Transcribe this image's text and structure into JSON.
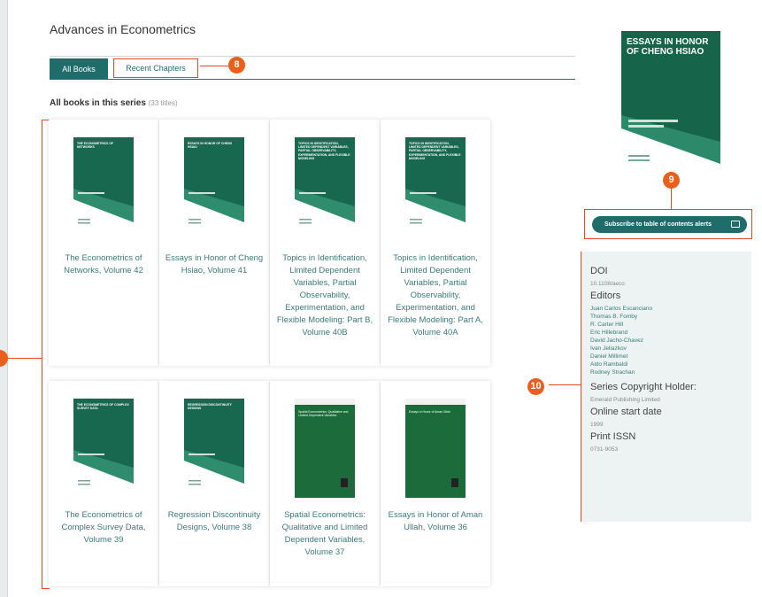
{
  "series_title": "Advances in Econometrics",
  "tabs": {
    "active": "All Books",
    "other": "Recent Chapters"
  },
  "section": {
    "heading": "All books in this series",
    "count": "(33 titles)"
  },
  "badges": {
    "b8": "8",
    "b9": "9",
    "b10": "10"
  },
  "books": [
    {
      "title": "The Econometrics of Networks, Volume 42",
      "cover_text": "THE ECONOMETRICS OF NETWORKS",
      "cover_style": "teal"
    },
    {
      "title": "Essays in Honor of Cheng Hsiao, Volume 41",
      "cover_text": "ESSAYS IN HONOR OF CHENG HSIAO",
      "cover_style": "teal"
    },
    {
      "title": "Topics in Identification, Limited Dependent Variables, Partial Observability, Experimentation, and Flexible Modeling: Part B, Volume 40B",
      "cover_text": "TOPICS IN IDENTIFICATION, LIMITED DEPENDENT VARIABLES, PARTIAL OBSERVABILITY, EXPERIMENTATION, AND FLEXIBLE MODELING",
      "cover_style": "teal"
    },
    {
      "title": "Topics in Identification, Limited Dependent Variables, Partial Observability, Experimentation, and Flexible Modeling: Part A, Volume 40A",
      "cover_text": "TOPICS IN IDENTIFICATION, LIMITED DEPENDENT VARIABLES, PARTIAL OBSERVABILITY, EXPERIMENTATION, AND FLEXIBLE MODELING",
      "cover_style": "teal"
    },
    {
      "title": "The Econometrics of Complex Survey Data, Volume 39",
      "cover_text": "THE ECONOMETRICS OF COMPLEX SURVEY DATA",
      "cover_style": "teal"
    },
    {
      "title": "Regression Discontinuity Designs, Volume 38",
      "cover_text": "REGRESSION DISCONTINUITY DESIGNS",
      "cover_style": "teal"
    },
    {
      "title": "Spatial Econometrics: Qualitative and Limited Dependent Variables, Volume 37",
      "cover_text": "Spatial Econometrics: Qualitative and Limited Dependent Variables",
      "cover_style": "green"
    },
    {
      "title": "Essays in Honor of Aman Ullah, Volume 36",
      "cover_text": "Essays in Honor of Aman Ullah",
      "cover_style": "green"
    }
  ],
  "featured_cover_text": "ESSAYS IN HONOR OF CHENG HSIAO",
  "subscribe_label": "Subscribe to table of contents alerts",
  "meta": {
    "doi_label": "DOI",
    "doi_value": "10.1108/aeco",
    "editors_label": "Editors",
    "editors": [
      "Juan Carlos Escanciano",
      "Thomas B. Fomby",
      "R. Carter Hill",
      "Eric Hillebrand",
      "David Jacho-Chavez",
      "Ivan Jeliazkov",
      "Daniel Millimet",
      "Aldo Rambaldi",
      "Rodney Strachan"
    ],
    "copyright_label": "Series Copyright Holder:",
    "copyright_value": "Emerald Publishing Limited",
    "start_label": "Online start date",
    "start_value": "1999",
    "issn_label": "Print ISSN",
    "issn_value": "0731-9053"
  },
  "colors": {
    "accent": "#1f6c6b",
    "highlight": "#e8481c",
    "badge": "#e9601c"
  }
}
